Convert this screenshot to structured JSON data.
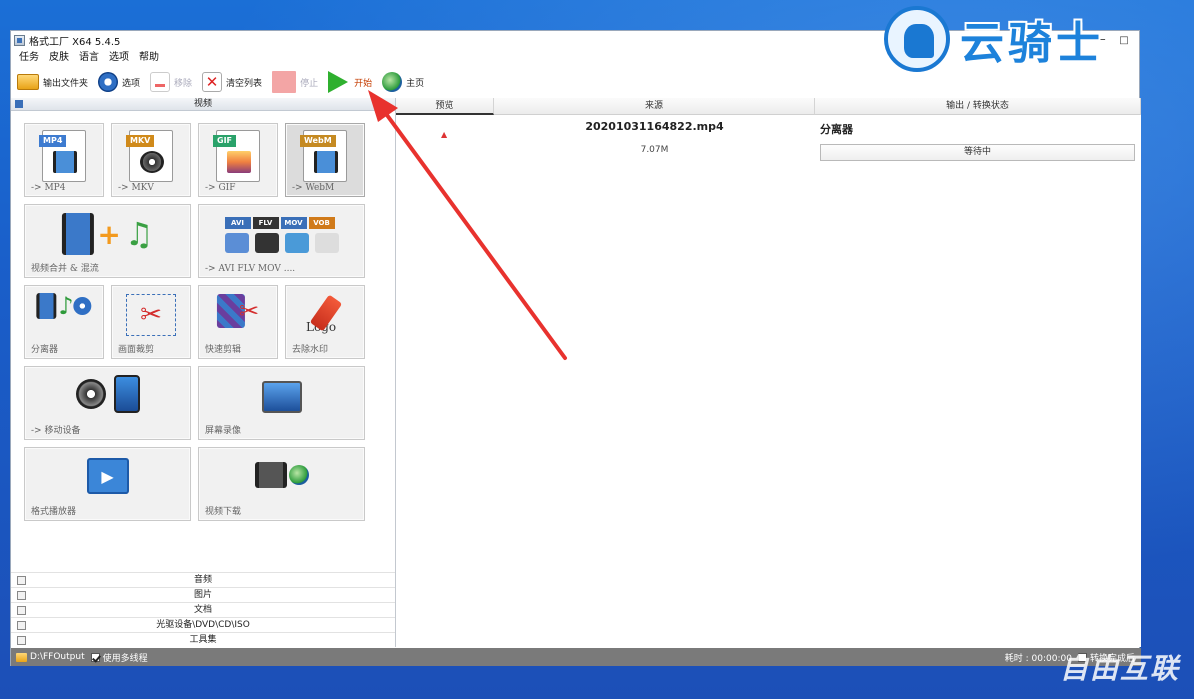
{
  "window": {
    "title": "格式工厂 X64 5.4.5",
    "menu": [
      "任务",
      "皮肤",
      "语言",
      "选项",
      "帮助"
    ]
  },
  "toolbar": {
    "output_folder": "输出文件夹",
    "options": "选项",
    "remove": "移除",
    "clear_list": "清空列表",
    "stop": "停止",
    "start": "开始",
    "home": "主页"
  },
  "left": {
    "header": "视频",
    "tiles": {
      "mp4": "-> MP4",
      "mkv": "-> MKV",
      "gif": "-> GIF",
      "webm": "-> WebM",
      "merge": "视频合并 & 混流",
      "avi": "-> AVI FLV MOV ....",
      "splitter": "分离器",
      "crop": "画面裁剪",
      "quick_cut": "快速剪辑",
      "remove_watermark": "去除水印",
      "mobile": "-> 移动设备",
      "screen_record": "屏幕录像",
      "player": "格式播放器",
      "download": "视频下载"
    },
    "badges": {
      "mp4": "MP4",
      "mkv": "MKV",
      "gif": "GIF",
      "webm": "WebM",
      "avi": "AVI",
      "flv": "FLV",
      "mov": "MOV",
      "vob": "VOB",
      "logo": "Logo"
    },
    "sections": [
      "音频",
      "图片",
      "文档",
      "光驱设备\\DVD\\CD\\ISO",
      "工具集"
    ]
  },
  "right": {
    "columns": [
      "预览",
      "来源",
      "输出 / 转换状态"
    ],
    "task": {
      "preview_mark": "▲",
      "filename": "20201031164822.mp4",
      "size": "7.07M",
      "output_type": "分离器",
      "status": "等待中"
    }
  },
  "statusbar": {
    "output_path": "D:\\FFOutput",
    "multithread": "使用多线程",
    "elapsed": "耗时 : 00:00:00",
    "after_convert": "转换完成后"
  },
  "watermarks": {
    "top": "云骑士",
    "bottom": "自由互联"
  },
  "colors": {
    "desktop": "#1a5ec9",
    "start_green": "#2fb02f",
    "arrow_red": "#e8322e",
    "statusbar": "#7a7a7a"
  }
}
